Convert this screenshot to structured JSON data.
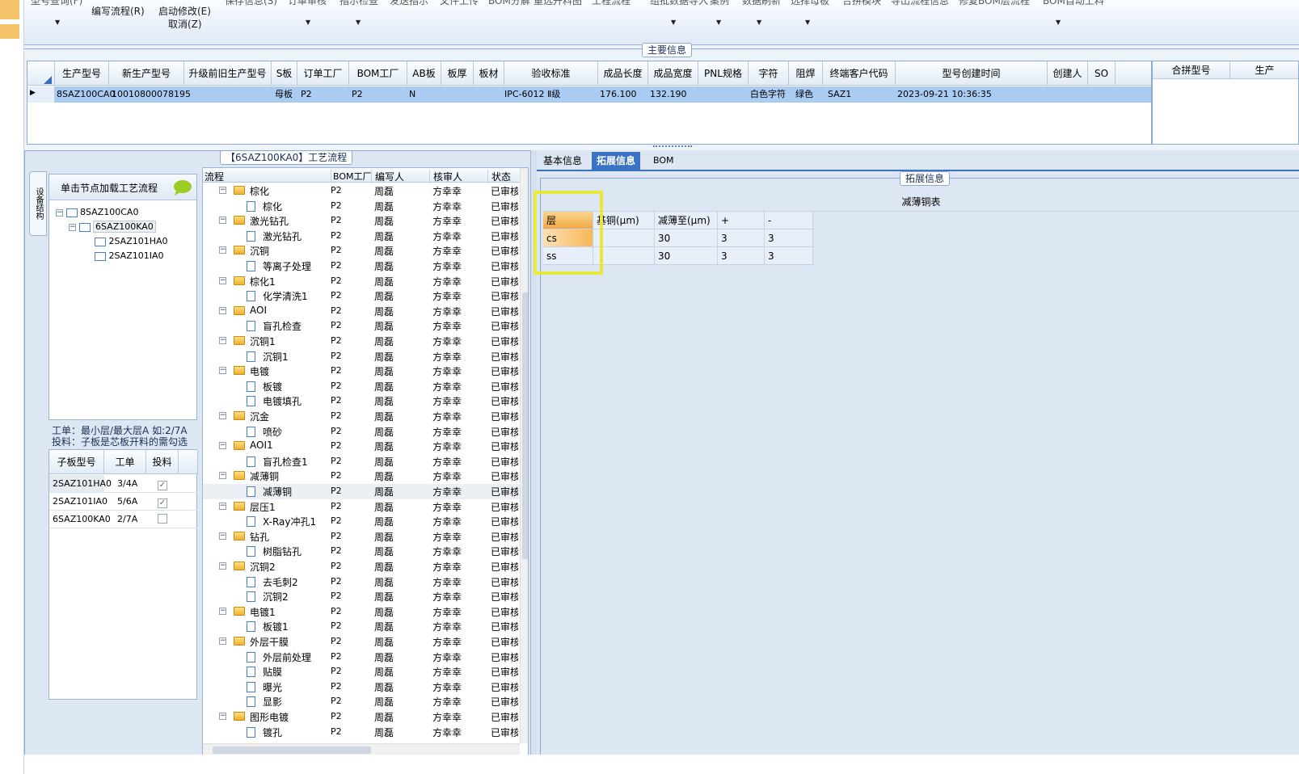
{
  "toolbar": {
    "top_row_partial": [
      "型号查询(F)",
      "保存信息(S)",
      "订单审核",
      "指示检查",
      "发送指示",
      "文件上传",
      "BOM分解",
      "重选开料图",
      "工程流程",
      "组批数据导入",
      "案例",
      "数据刷新",
      "选择母板",
      "合拼模块",
      "导出流程信息",
      "修复BOM层流程",
      "BOM自动上料"
    ],
    "edit_flow": "编写流程(R)",
    "enable_modify": "启动修改(E)",
    "cancel": "取消(Z)"
  },
  "main_info": {
    "title": "主要信息",
    "columns": [
      "生产型号",
      "新生产型号",
      "升级前旧生产型号",
      "S板",
      "订单工厂",
      "BOM工厂",
      "AB板",
      "板厚",
      "板材",
      "验收标准",
      "成品长度",
      "成品宽度",
      "PNL规格",
      "字符",
      "阻焊",
      "终端客户代码",
      "型号创建时间",
      "创建人",
      "SO"
    ],
    "row": {
      "model": "8SAZ100CA0",
      "new_model": "10010800078195",
      "s_board": "母板",
      "order_factory": "P2",
      "bom_factory": "P2",
      "ab": "N",
      "standard": "IPC-6012 Ⅱ级",
      "length": "176.100",
      "width": "132.190",
      "char": "白色字符",
      "mask": "绿色",
      "customer": "SAZ1",
      "created": "2023-09-21 10:36:35"
    },
    "side_columns": [
      "合拼型号",
      "生产"
    ]
  },
  "left_panel": {
    "side_tab": "设备结构",
    "load_hint": "单击节点加载工艺流程",
    "tree": [
      "8SAZ100CA0",
      "6SAZ100KA0",
      "2SAZ101HA0",
      "2SAZ101IA0"
    ],
    "note1": "工单：最小层/最大层A 如:2/7A",
    "note2": "投料：子板是芯板开料的需勾选",
    "sub_columns": [
      "子板型号",
      "工单",
      "投料"
    ],
    "sub_rows": [
      {
        "model": "2SAZ101HA0",
        "order": "3/4A",
        "feed": "✓"
      },
      {
        "model": "2SAZ101IA0",
        "order": "5/6A",
        "feed": "✓"
      },
      {
        "model": "6SAZ100KA0",
        "order": "2/7A",
        "feed": ""
      }
    ]
  },
  "flow_panel": {
    "title": "【6SAZ100KA0】工艺流程",
    "columns": [
      "流程",
      "BOM工厂",
      "编写人",
      "核审人",
      "状态"
    ],
    "factory": "P2",
    "writer": "周磊",
    "reviewer": "方幸幸",
    "status": "已审核",
    "rows": [
      {
        "name": "棕化",
        "type": "folder"
      },
      {
        "name": "棕化",
        "type": "doc"
      },
      {
        "name": "激光钻孔",
        "type": "folder"
      },
      {
        "name": "激光钻孔",
        "type": "doc"
      },
      {
        "name": "沉铜",
        "type": "folder"
      },
      {
        "name": "等离子处理",
        "type": "doc"
      },
      {
        "name": "棕化1",
        "type": "folder"
      },
      {
        "name": "化学清洗1",
        "type": "doc"
      },
      {
        "name": "AOI",
        "type": "folder"
      },
      {
        "name": "盲孔检查",
        "type": "doc"
      },
      {
        "name": "沉铜1",
        "type": "folder"
      },
      {
        "name": "沉铜1",
        "type": "doc"
      },
      {
        "name": "电镀",
        "type": "folder"
      },
      {
        "name": "板镀",
        "type": "doc"
      },
      {
        "name": "电镀填孔",
        "type": "doc"
      },
      {
        "name": "沉金",
        "type": "folder"
      },
      {
        "name": "喷砂",
        "type": "doc"
      },
      {
        "name": "AOI1",
        "type": "folder"
      },
      {
        "name": "盲孔检查1",
        "type": "doc"
      },
      {
        "name": "减薄铜",
        "type": "folder"
      },
      {
        "name": "减薄铜",
        "type": "doc"
      },
      {
        "name": "层压1",
        "type": "folder"
      },
      {
        "name": "X-Ray冲孔1",
        "type": "doc"
      },
      {
        "name": "钻孔",
        "type": "folder"
      },
      {
        "name": "树脂钻孔",
        "type": "doc"
      },
      {
        "name": "沉铜2",
        "type": "folder"
      },
      {
        "name": "去毛刺2",
        "type": "doc"
      },
      {
        "name": "沉铜2",
        "type": "doc"
      },
      {
        "name": "电镀1",
        "type": "folder"
      },
      {
        "name": "板镀1",
        "type": "doc"
      },
      {
        "name": "外层干膜",
        "type": "folder"
      },
      {
        "name": "外层前处理",
        "type": "doc"
      },
      {
        "name": "贴膜",
        "type": "doc"
      },
      {
        "name": "曝光",
        "type": "doc"
      },
      {
        "name": "显影",
        "type": "doc"
      },
      {
        "name": "图形电镀",
        "type": "folder"
      },
      {
        "name": "镀孔",
        "type": "doc"
      }
    ]
  },
  "right_panel": {
    "tabs": [
      "基本信息",
      "拓展信息",
      "BOM"
    ],
    "ext_title": "拓展信息",
    "table_title": "减薄铜表",
    "columns": [
      "层",
      "基铜(μm)",
      "减薄至(μm)",
      "+",
      "-"
    ],
    "rows": [
      {
        "layer": "cs",
        "base": "",
        "thin": "30",
        "plus": "3",
        "minus": "3"
      },
      {
        "layer": "ss",
        "base": "",
        "thin": "30",
        "plus": "3",
        "minus": "3"
      }
    ],
    "highlight_color": "#e8e83a"
  }
}
